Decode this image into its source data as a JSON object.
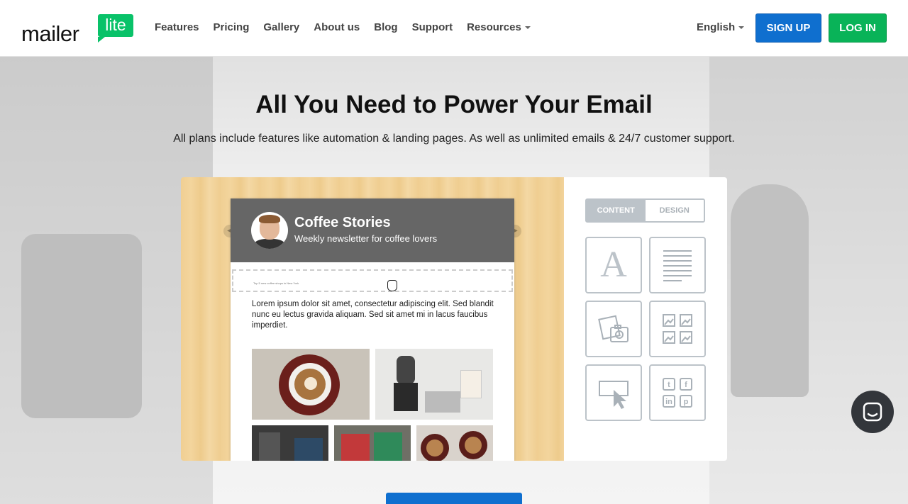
{
  "header": {
    "logo": {
      "word": "mailer",
      "badge": "lite"
    },
    "nav": [
      {
        "label": "Features"
      },
      {
        "label": "Pricing"
      },
      {
        "label": "Gallery"
      },
      {
        "label": "About us"
      },
      {
        "label": "Blog"
      },
      {
        "label": "Support"
      },
      {
        "label": "Resources",
        "has_dropdown": true
      }
    ],
    "language": "English",
    "signup_label": "SIGN UP",
    "login_label": "LOG IN"
  },
  "hero": {
    "title": "All You Need to Power Your Email",
    "subtitle": "All plans include features like automation & landing pages. As well as unlimited emails & 24/7 customer support."
  },
  "editor": {
    "newsletter": {
      "title": "Coffee Stories",
      "subtitle": "Weekly newsletter for coffee lovers",
      "tiny_text": "Top 5 new coffee shops in New York",
      "body": "Lorem ipsum dolor sit amet, consectetur adipiscing elit. Sed blandit nunc eu lectus gravida aliquam. Sed sit amet mi in lacus faucibus imperdiet."
    },
    "tabs": [
      {
        "label": "CONTENT",
        "active": true
      },
      {
        "label": "DESIGN",
        "active": false
      }
    ],
    "tools": [
      {
        "icon": "text-block-icon",
        "glyph": "A"
      },
      {
        "icon": "paragraph-icon"
      },
      {
        "icon": "image-icon"
      },
      {
        "icon": "gallery-icon"
      },
      {
        "icon": "button-icon"
      },
      {
        "icon": "social-icon"
      }
    ]
  },
  "colors": {
    "brand_green": "#09c269",
    "signup_blue": "#0f6fcf",
    "login_green": "#09b358",
    "tool_border": "#bcc3c9"
  }
}
